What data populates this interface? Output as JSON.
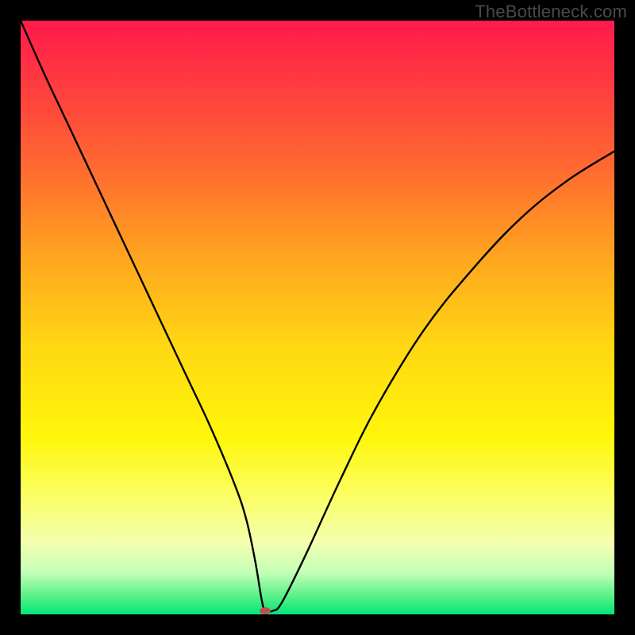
{
  "watermark": "TheBottleneck.com",
  "chart_data": {
    "type": "line",
    "title": "",
    "xlabel": "",
    "ylabel": "",
    "xlim": [
      0,
      100
    ],
    "ylim": [
      0,
      100
    ],
    "grid": false,
    "gradient_stops": [
      {
        "pct": 0,
        "color": "#ff1a4b"
      },
      {
        "pct": 10,
        "color": "#ff3940"
      },
      {
        "pct": 25,
        "color": "#ff6a30"
      },
      {
        "pct": 40,
        "color": "#ffa61f"
      },
      {
        "pct": 55,
        "color": "#ffd813"
      },
      {
        "pct": 70,
        "color": "#fff60a"
      },
      {
        "pct": 80,
        "color": "#fbff63"
      },
      {
        "pct": 88,
        "color": "#f3ffb0"
      },
      {
        "pct": 93,
        "color": "#c3ffb8"
      },
      {
        "pct": 97,
        "color": "#57f086"
      },
      {
        "pct": 100,
        "color": "#00e67a"
      }
    ],
    "series": [
      {
        "name": "bottleneck-curve",
        "stroke": "#000000",
        "x": [
          0,
          4,
          8,
          12,
          16,
          20,
          24,
          28,
          32,
          36,
          38,
          39.5,
          40.5,
          41,
          41.5,
          42.5,
          44,
          48,
          54,
          60,
          68,
          76,
          84,
          92,
          100
        ],
        "y": [
          100,
          91,
          82.5,
          74,
          65.5,
          57,
          48.5,
          40,
          31.5,
          22,
          16,
          9,
          3,
          0.8,
          0.6,
          0.6,
          2,
          10,
          23,
          35,
          48,
          58,
          66.5,
          73,
          78
        ]
      }
    ],
    "marker": {
      "name": "optimal-point",
      "x": 41.2,
      "y": 0.6,
      "color": "#c05050",
      "rx": 7,
      "ry": 4.5
    }
  }
}
